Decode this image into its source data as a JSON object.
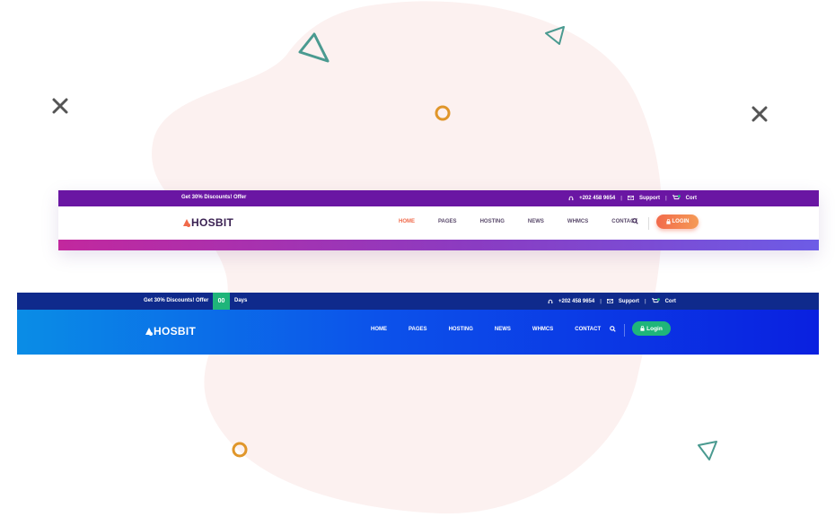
{
  "colors": {
    "blob": "#fcf1f0",
    "shape_teal": "#4a9a90",
    "shape_orange": "#e0962a",
    "shape_gray": "#555555"
  },
  "header_purple": {
    "offer_text": "Get 30% Discounts! Offer",
    "phone": "+202 458 9654",
    "support": "Support",
    "cart": "Cort",
    "logo_text": "HOSBIT",
    "nav": [
      "HOME",
      "PAGES",
      "HOSTING",
      "NEWS",
      "WHMCS",
      "CONTACT"
    ],
    "active_nav": "HOME",
    "login_label": "LOGIN",
    "topbar_color": "#6a16a3",
    "accent_color": "#f06a4b"
  },
  "header_blue": {
    "offer_text": "Get 30% Discounts! Offer",
    "countdown_value": "00",
    "countdown_unit": "Days",
    "phone": "+202 458 9654",
    "support": "Support",
    "cart": "Cort",
    "logo_text": "HOSBIT",
    "nav": [
      "HOME",
      "PAGES",
      "HOSTING",
      "NEWS",
      "WHMCS",
      "CONTACT"
    ],
    "login_label": "Login",
    "topbar_color": "#0f2a8c",
    "accent_color": "#1fb57a"
  }
}
